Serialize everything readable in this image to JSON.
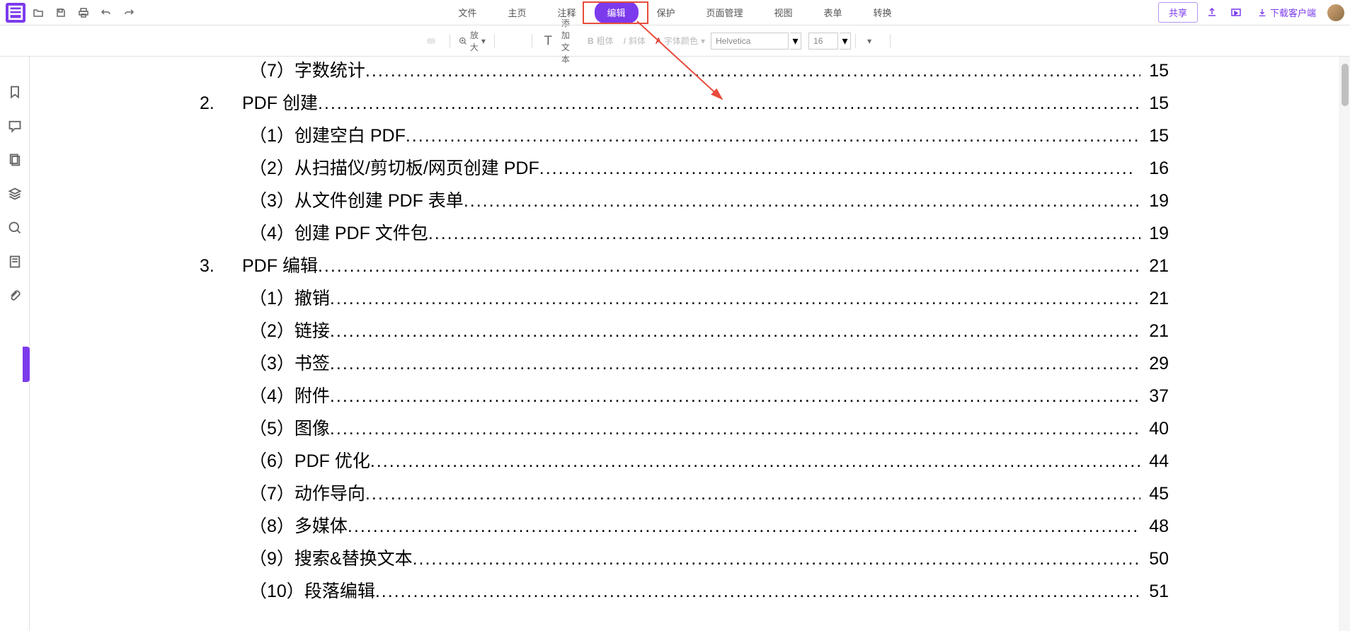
{
  "topTabs": {
    "file": "文件",
    "home": "主页",
    "annotate": "注释",
    "edit": "编辑",
    "protect": "保护",
    "pageManage": "页面管理",
    "view": "视图",
    "form": "表单",
    "convert": "转换"
  },
  "topRight": {
    "share": "共享",
    "download": "下载客户端"
  },
  "editToolbar": {
    "zoom": "放大",
    "addText": "添加文本",
    "bold": "粗体",
    "italic": "斜体",
    "fontColor": "字体颜色",
    "fontName": "Helvetica",
    "fontSize": "16"
  },
  "toc": [
    {
      "type": "sub",
      "num": "（7）",
      "title": "字数统计",
      "page": "15"
    },
    {
      "type": "section",
      "num": "2.",
      "title": "PDF 创建",
      "page": "15"
    },
    {
      "type": "sub",
      "num": "（1）",
      "title": "创建空白 PDF",
      "page": "15"
    },
    {
      "type": "sub",
      "num": "（2）",
      "title": "从扫描仪/剪切板/网页创建 PDF",
      "page": "16",
      "spaceBefore": true
    },
    {
      "type": "sub",
      "num": "（3）",
      "title": "从文件创建 PDF 表单",
      "page": "19"
    },
    {
      "type": "sub",
      "num": "（4）",
      "title": "创建 PDF 文件包",
      "page": "19"
    },
    {
      "type": "section",
      "num": "3.",
      "title": "PDF 编辑",
      "page": "21"
    },
    {
      "type": "sub",
      "num": "（1）",
      "title": " 撤销",
      "page": "21"
    },
    {
      "type": "sub",
      "num": "（2）",
      "title": " 链接",
      "page": "21"
    },
    {
      "type": "sub",
      "num": "（3）",
      "title": " 书签",
      "page": "29"
    },
    {
      "type": "sub",
      "num": "（4）",
      "title": " 附件",
      "page": "37"
    },
    {
      "type": "sub",
      "num": "（5）",
      "title": " 图像",
      "page": "40"
    },
    {
      "type": "sub",
      "num": "（6）",
      "title": " PDF 优化",
      "page": "44"
    },
    {
      "type": "sub",
      "num": "（7）",
      "title": " 动作导向",
      "page": "45"
    },
    {
      "type": "sub",
      "num": "（8）",
      "title": " 多媒体",
      "page": "48"
    },
    {
      "type": "sub",
      "num": "（9）",
      "title": " 搜索&替换文本",
      "page": "50"
    },
    {
      "type": "sub",
      "num": "（10）",
      "title": " 段落编辑",
      "page": "51"
    }
  ]
}
